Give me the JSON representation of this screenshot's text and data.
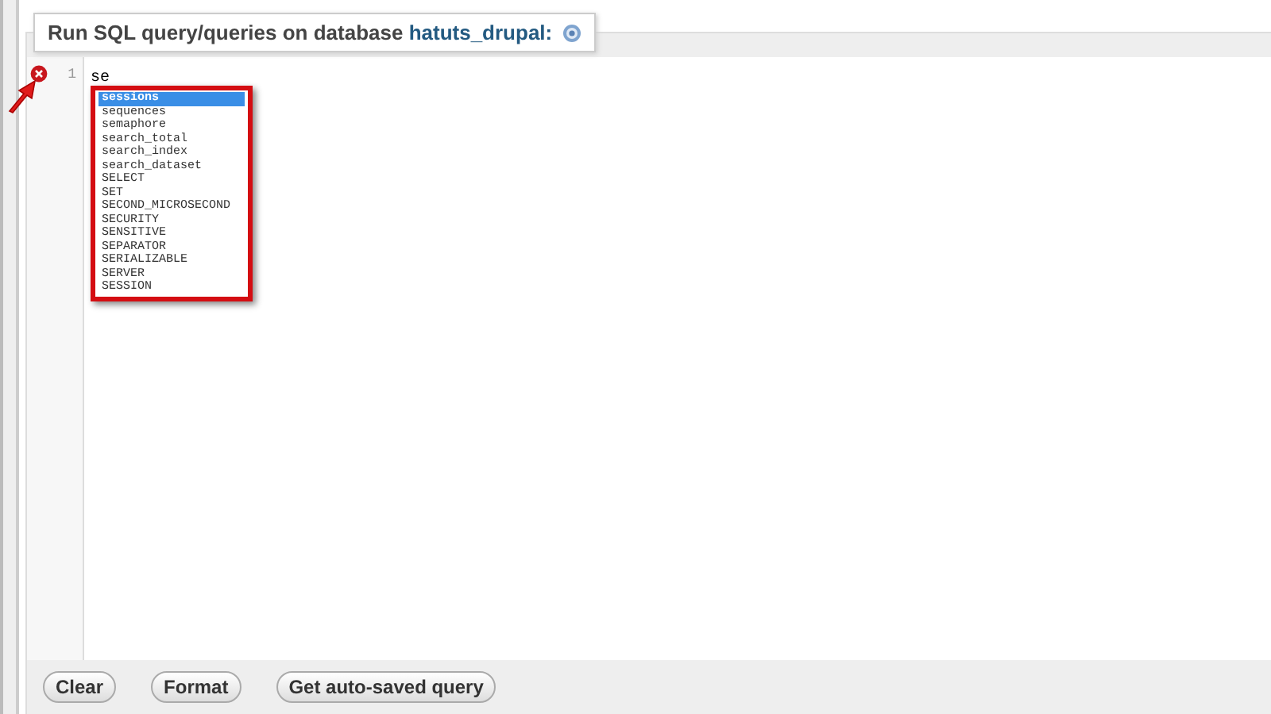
{
  "panel": {
    "legend": "Run SQL query/queries on database",
    "database": "hatuts_drupal:"
  },
  "editor": {
    "line_numbers": [
      "1"
    ],
    "text": "se",
    "error": true
  },
  "autocomplete": [
    {
      "label": "sessions",
      "selected": true
    },
    {
      "label": "sequences",
      "selected": false
    },
    {
      "label": "semaphore",
      "selected": false
    },
    {
      "label": "search_total",
      "selected": false
    },
    {
      "label": "search_index",
      "selected": false
    },
    {
      "label": "search_dataset",
      "selected": false
    },
    {
      "label": "SELECT",
      "selected": false
    },
    {
      "label": "SET",
      "selected": false
    },
    {
      "label": "SECOND_MICROSECOND",
      "selected": false
    },
    {
      "label": "SECURITY",
      "selected": false
    },
    {
      "label": "SENSITIVE",
      "selected": false
    },
    {
      "label": "SEPARATOR",
      "selected": false
    },
    {
      "label": "SERIALIZABLE",
      "selected": false
    },
    {
      "label": "SERVER",
      "selected": false
    },
    {
      "label": "SESSION",
      "selected": false
    }
  ],
  "buttons": [
    "Clear",
    "Format",
    "Get auto-saved query"
  ]
}
